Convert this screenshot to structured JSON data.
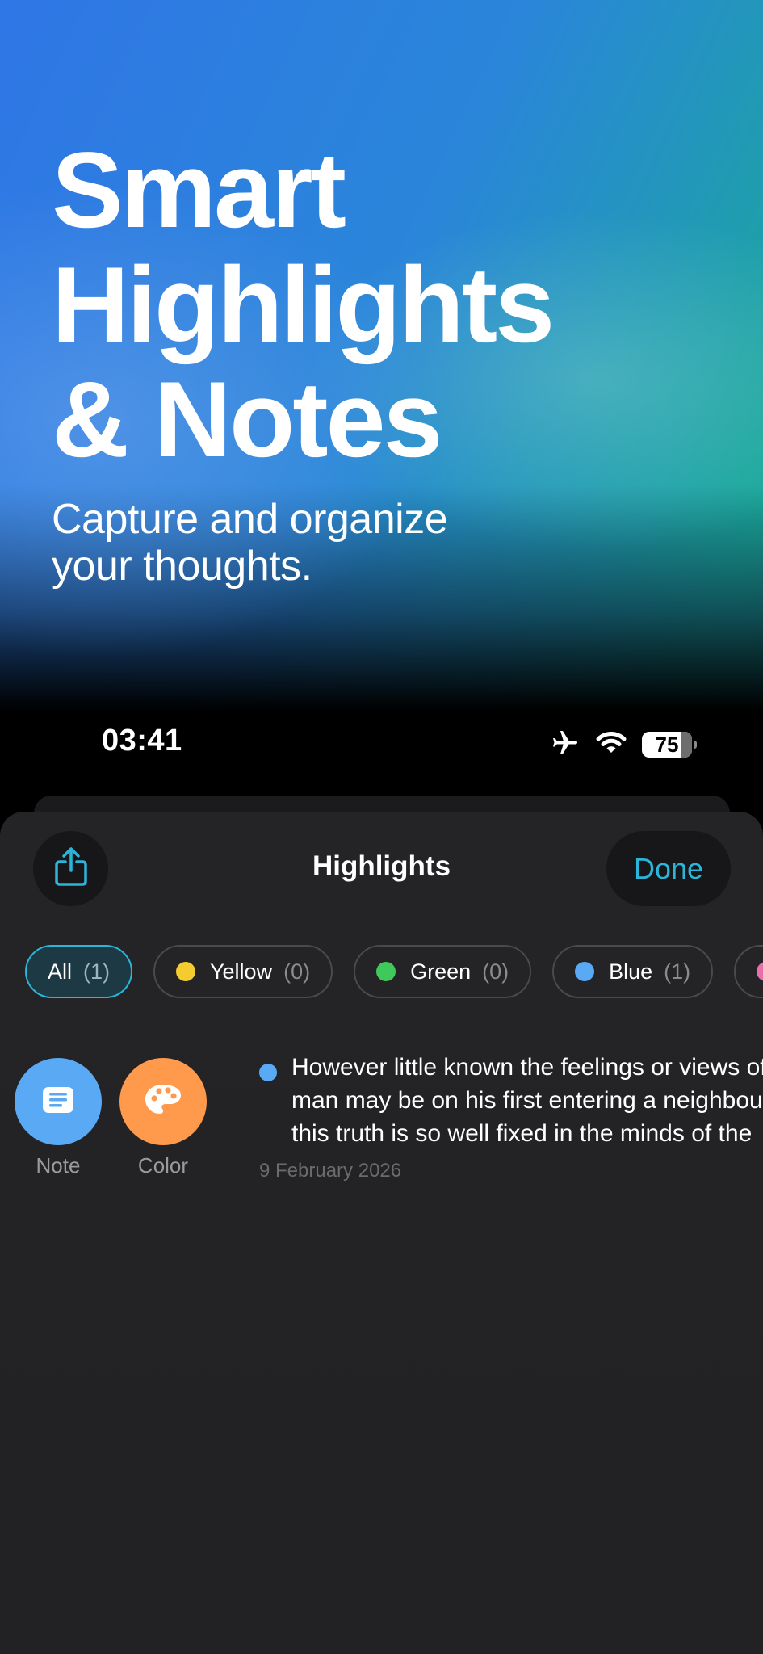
{
  "hero": {
    "title_lines": [
      "Smart",
      "Highlights",
      "& Notes"
    ],
    "subtitle_lines": [
      "Capture and organize",
      "your thoughts."
    ]
  },
  "status_bar": {
    "time": "03:41",
    "battery": "75",
    "icons": [
      "airplane-icon",
      "wifi-icon",
      "battery-icon"
    ]
  },
  "sheet": {
    "title": "Highlights",
    "share_icon": "share-icon",
    "done_label": "Done"
  },
  "filters": [
    {
      "label": "All",
      "count": "(1)",
      "color": "",
      "active": true
    },
    {
      "label": "Yellow",
      "count": "(0)",
      "color": "#f5cc2e",
      "active": false
    },
    {
      "label": "Green",
      "count": "(0)",
      "color": "#3fc95a",
      "active": false
    },
    {
      "label": "Blue",
      "count": "(1)",
      "color": "#5aa9f5",
      "active": false
    },
    {
      "label": "",
      "count": "",
      "color": "#e870a8",
      "active": false
    }
  ],
  "actions": [
    {
      "label": "Note",
      "icon": "note-icon",
      "color": "#5aa9f5"
    },
    {
      "label": "Color",
      "icon": "palette-icon",
      "color": "#ff9a4d"
    }
  ],
  "highlight": {
    "color": "#5aa9f5",
    "text_lines": [
      "However little known the feelings or views of such a",
      "man may be on his first entering a neighbourhood,",
      "this truth is so well fixed in the minds of the"
    ],
    "date": "9 February 2026"
  },
  "colors": {
    "accent": "#2bb5d8",
    "sheet_bg": "#232325"
  }
}
